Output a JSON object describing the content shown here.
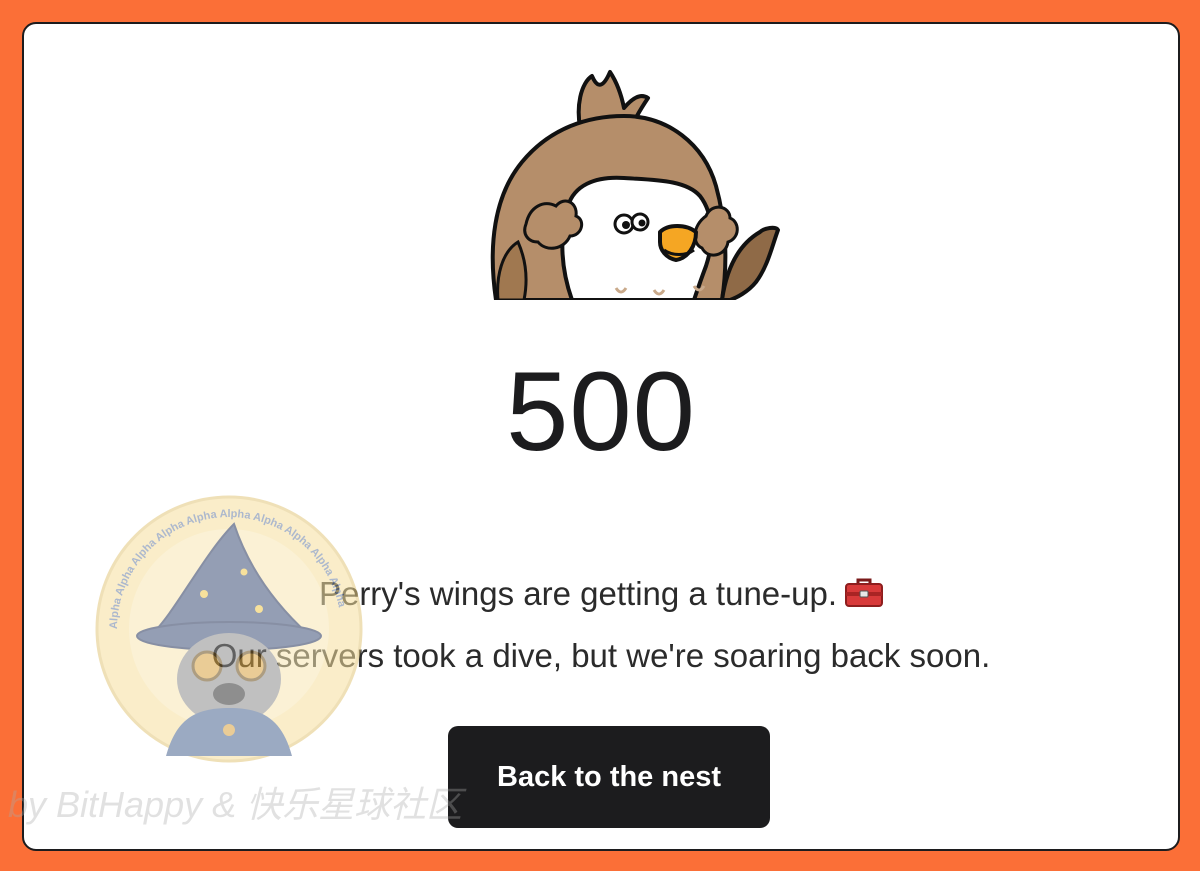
{
  "error_page": {
    "status_code": "500",
    "message_line_1": "Perry's wings are getting a tune-up.",
    "message_line_1_emoji": "toolbox-icon",
    "message_line_2": "Our servers took a dive, but we're soaring back soon.",
    "back_button_label": "Back to the nest",
    "mascot": "perry-bird-mascot"
  },
  "overlay": {
    "watermark_text": "by BitHappy & 快乐星球社区",
    "seal_ring_text": "Alpha Alpha Alpha Alpha Alpha Alpha Alpha Alpha Alpha Alpha"
  },
  "colors": {
    "frame_background": "#fb6f37",
    "card_background": "#ffffff",
    "text_primary": "#1c1c1e",
    "button_background": "#1c1c1e",
    "button_text": "#ffffff",
    "mascot_brown": "#b58e6a",
    "mascot_beak": "#f5a623"
  }
}
